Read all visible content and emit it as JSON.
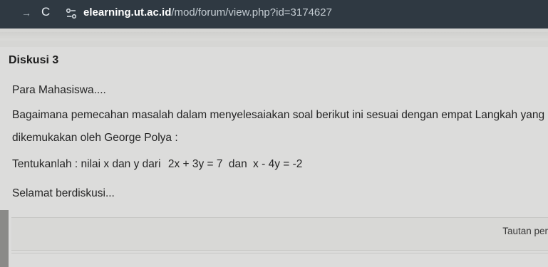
{
  "browser": {
    "url_host": "elearning.ut.ac.id",
    "url_path": "/mod/forum/view.php?id=3174627",
    "icons": [
      "forward-icon",
      "reload-icon",
      "site-info-icon"
    ]
  },
  "post": {
    "title": "Diskusi 3",
    "greeting": "Para Mahasiswa....",
    "question_line1": "Bagaimana pemecahan masalah dalam menyelesaiakan soal berikut ini sesuai dengan empat Langkah yang",
    "question_line2": "dikemukakan oleh George Polya :",
    "task_prefix": "Tentukanlah : nilai x dan y dari",
    "equation1": "2x + 3y = 7",
    "connector": "dan",
    "equation2": "x - 4y = -2",
    "closing": "Selamat berdiskusi..."
  },
  "footer": {
    "link_label": "Tautan per"
  }
}
